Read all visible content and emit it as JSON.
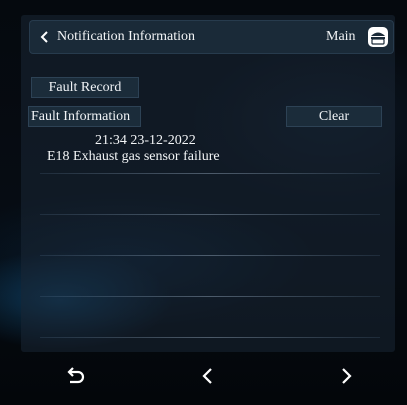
{
  "header": {
    "title": "Notification Information",
    "main_label": "Main",
    "back_icon": "chevron-left-icon",
    "home_icon": "home-icon"
  },
  "buttons": {
    "fault_record": "Fault Record",
    "fault_information": "Fault Information",
    "clear": "Clear"
  },
  "records": [
    {
      "time": "21:34 23-12-2022",
      "message": "E18 Exhaust gas sensor failure"
    }
  ],
  "bottom_nav": {
    "return_icon": "return-icon",
    "prev_icon": "chevron-left-icon",
    "next_icon": "chevron-right-icon"
  },
  "colors": {
    "background": "#03070c",
    "header": "#1a2a38",
    "button": "#1b2c3a",
    "text": "#f0f3f6"
  }
}
